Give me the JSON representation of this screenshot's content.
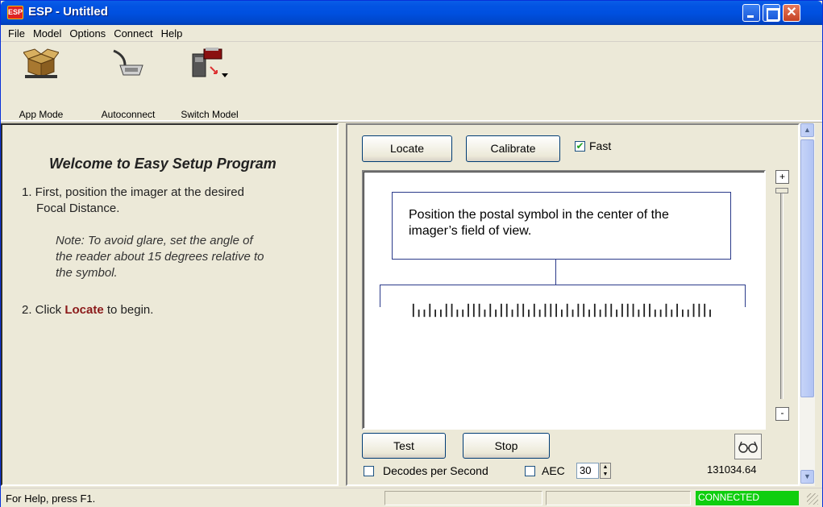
{
  "window": {
    "title": "ESP - Untitled",
    "app_icon_text": "ESP"
  },
  "menu": {
    "items": [
      "File",
      "Model",
      "Options",
      "Connect",
      "Help"
    ]
  },
  "toolbar": {
    "items": [
      {
        "label": "App Mode",
        "icon": "box-icon"
      },
      {
        "label": "Autoconnect",
        "icon": "cable-connector-icon"
      },
      {
        "label": "Switch Model",
        "icon": "scanner-icon"
      }
    ]
  },
  "left": {
    "heading": "Welcome to Easy Setup Program",
    "step1_line1": "1. First, position the imager at the desired",
    "step1_line2": "Focal Distance.",
    "note_line1": "Note: To avoid glare, set the angle of",
    "note_line2": "the reader about 15 degrees relative to",
    "note_line3": "the symbol.",
    "step2_prefix": "2. Click ",
    "step2_bold": "Locate",
    "step2_suffix": " to begin."
  },
  "right": {
    "locate_label": "Locate",
    "calibrate_label": "Calibrate",
    "fast_label": "Fast",
    "fast_checked": true,
    "message": "Position the postal symbol in the center of the imager’s field of view.",
    "slider_plus": "+",
    "slider_minus": "-",
    "test_label": "Test",
    "stop_label": "Stop",
    "decodes_label": "Decodes per Second",
    "decodes_checked": false,
    "aec_label": "AEC",
    "aec_checked": false,
    "aec_value": "30",
    "glasses_icon": "glasses-icon",
    "coord_value": "131034.64"
  },
  "status": {
    "help_text": "For Help, press F1.",
    "connection": "CONNECTED",
    "connection_color": "#0fce0f"
  }
}
